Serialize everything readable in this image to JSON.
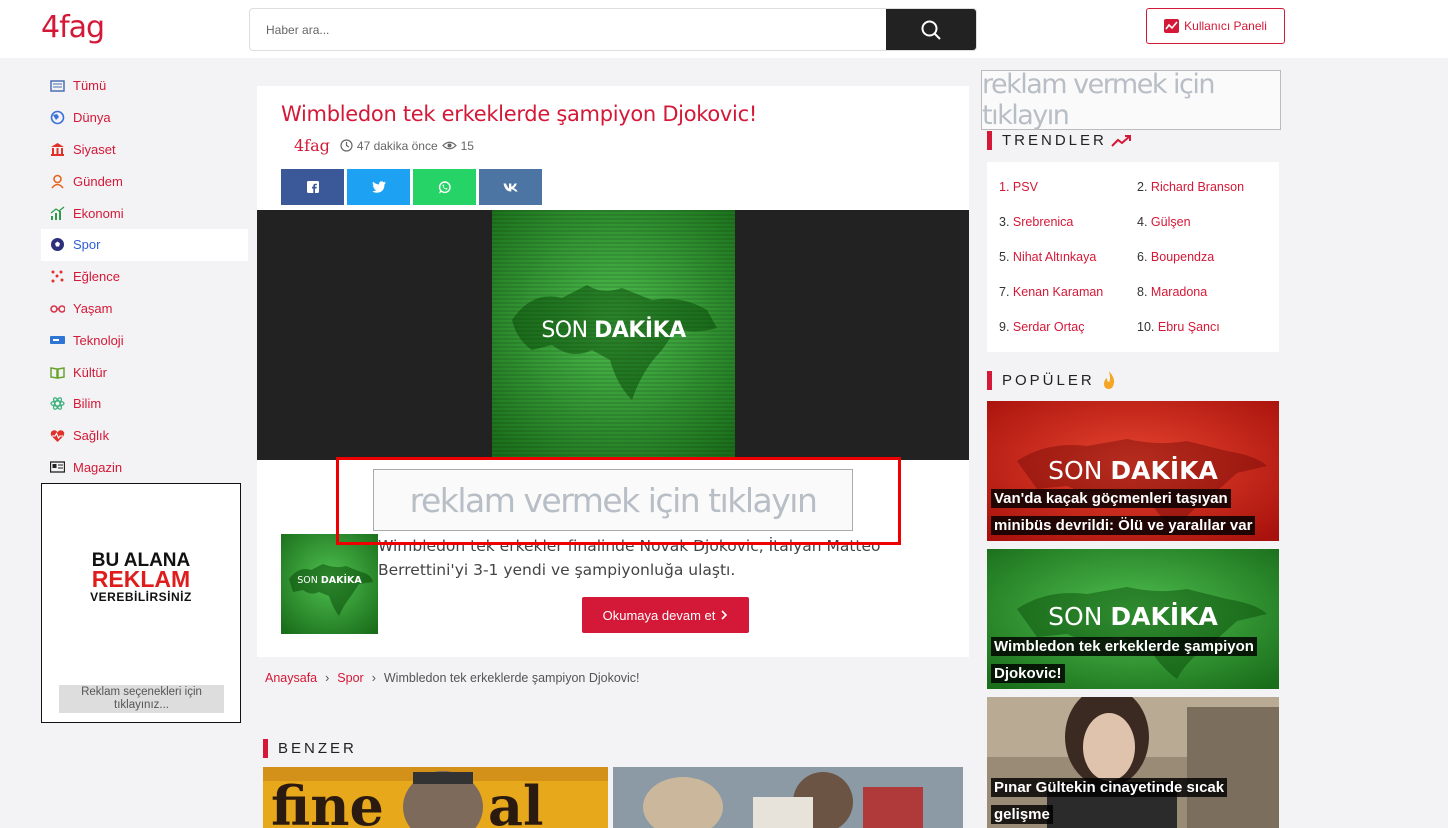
{
  "header": {
    "logo": "4fag",
    "search_placeholder": "Haber ara...",
    "panel_label": "Kullanıcı Paneli"
  },
  "sidebar": {
    "items": [
      {
        "label": "Tümü",
        "icon": "newspaper-icon",
        "active": false
      },
      {
        "label": "Dünya",
        "icon": "globe-icon",
        "active": false
      },
      {
        "label": "Siyaset",
        "icon": "parliament-icon",
        "active": false
      },
      {
        "label": "Gündem",
        "icon": "location-person-icon",
        "active": false
      },
      {
        "label": "Ekonomi",
        "icon": "chart-icon",
        "active": false
      },
      {
        "label": "Spor",
        "icon": "soccer-ball-icon",
        "active": true
      },
      {
        "label": "Eğlence",
        "icon": "confetti-icon",
        "active": false
      },
      {
        "label": "Yaşam",
        "icon": "glasses-icon",
        "active": false
      },
      {
        "label": "Teknoloji",
        "icon": "device-icon",
        "active": false
      },
      {
        "label": "Kültür",
        "icon": "book-icon",
        "active": false
      },
      {
        "label": "Bilim",
        "icon": "atom-icon",
        "active": false
      },
      {
        "label": "Sağlık",
        "icon": "heartbeat-icon",
        "active": false
      },
      {
        "label": "Magazin",
        "icon": "magazine-icon",
        "active": false
      }
    ],
    "ad": {
      "line1": "BU ALANA",
      "line2": "REKLAM",
      "line3": "VEREBİLİRSİNİZ",
      "link": "Reklam seçenekleri için tıklayınız..."
    }
  },
  "article": {
    "title": "Wimbledon tek erkeklerde şampiyon Djokovic!",
    "source": "4fag",
    "time": "47 dakika önce",
    "views": "15",
    "hero_text_light": "SON",
    "hero_text_bold": "DAKİKA",
    "excerpt": "Wimbledon tek erkekler finalinde Novak Djokovic, İtalyan Matteo Berrettini'yi 3-1 yendi ve şampiyonluğa ulaştı.",
    "more_label": "Okumaya devam et",
    "inline_ad": "reklam vermek için tıklayın"
  },
  "breadcrumb": {
    "home": "Anaysafa",
    "category": "Spor",
    "current": "Wimbledon tek erkeklerde şampiyon Djokovic!"
  },
  "benzer": {
    "title": "BENZER"
  },
  "right": {
    "ad": "reklam vermek için tıklayın",
    "trends_title": "TRENDLER",
    "trends": [
      {
        "n": "1.",
        "label": "PSV"
      },
      {
        "n": "2.",
        "label": "Richard Branson"
      },
      {
        "n": "3.",
        "label": "Srebrenica"
      },
      {
        "n": "4.",
        "label": "Gülşen"
      },
      {
        "n": "5.",
        "label": "Nihat Altınkaya"
      },
      {
        "n": "6.",
        "label": "Boupendza"
      },
      {
        "n": "7.",
        "label": "Kenan Karaman"
      },
      {
        "n": "8.",
        "label": "Maradona"
      },
      {
        "n": "9.",
        "label": "Serdar Ortaç"
      },
      {
        "n": "10.",
        "label": "Ebru Şancı"
      }
    ],
    "popular_title": "POPÜLER",
    "popular": [
      {
        "line1": "Van'da kaçak göçmenleri taşıyan",
        "line2": "minibüs devrildi: Ölü ve yaralılar var"
      },
      {
        "line1": "Wimbledon tek erkeklerde şampiyon",
        "line2": "Djokovic!"
      },
      {
        "line1": "Pınar Gültekin cinayetinde sıcak",
        "line2": "gelişme"
      }
    ]
  },
  "colors": {
    "brand": "#d41837",
    "active": "#2b5fd6",
    "green": "#2f8f2f"
  }
}
